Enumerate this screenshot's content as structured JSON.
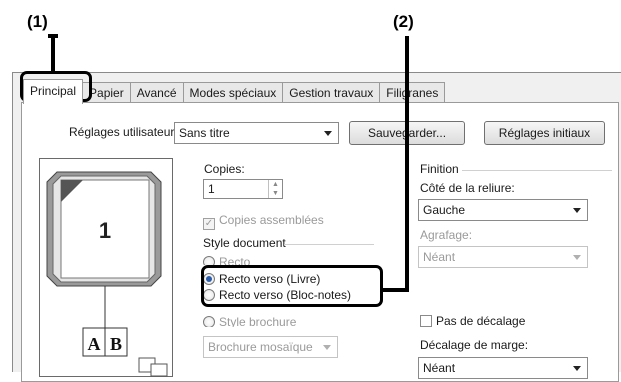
{
  "callouts": {
    "one": "(1)",
    "two": "(2)"
  },
  "tabs": [
    "Principal",
    "Papier",
    "Avancé",
    "Modes spéciaux",
    "Gestion travaux",
    "Filigranes"
  ],
  "toolbar": {
    "user_settings_label": "Réglages utilisateur:",
    "user_settings_value": "Sans titre",
    "save_label": "Sauvegarder...",
    "defaults_label": "Réglages initiaux"
  },
  "preview": {
    "page_number": "1",
    "book_letters": [
      "A",
      "B"
    ]
  },
  "copies": {
    "label": "Copies:",
    "value": "1",
    "collate_label": "Copies assemblées"
  },
  "document_style": {
    "label": "Style document",
    "options": [
      "Recto",
      "Recto verso (Livre)",
      "Recto verso (Bloc-notes)",
      "Style brochure"
    ],
    "selected_index": 1,
    "brochure_value": "Brochure mosaïque"
  },
  "finishing": {
    "label": "Finition",
    "binding_label": "Côté de la reliure:",
    "binding_value": "Gauche",
    "staple_label": "Agrafage:",
    "staple_value": "Néant",
    "no_offset_label": "Pas de décalage",
    "margin_shift_label": "Décalage de marge:",
    "margin_shift_value": "Néant"
  }
}
